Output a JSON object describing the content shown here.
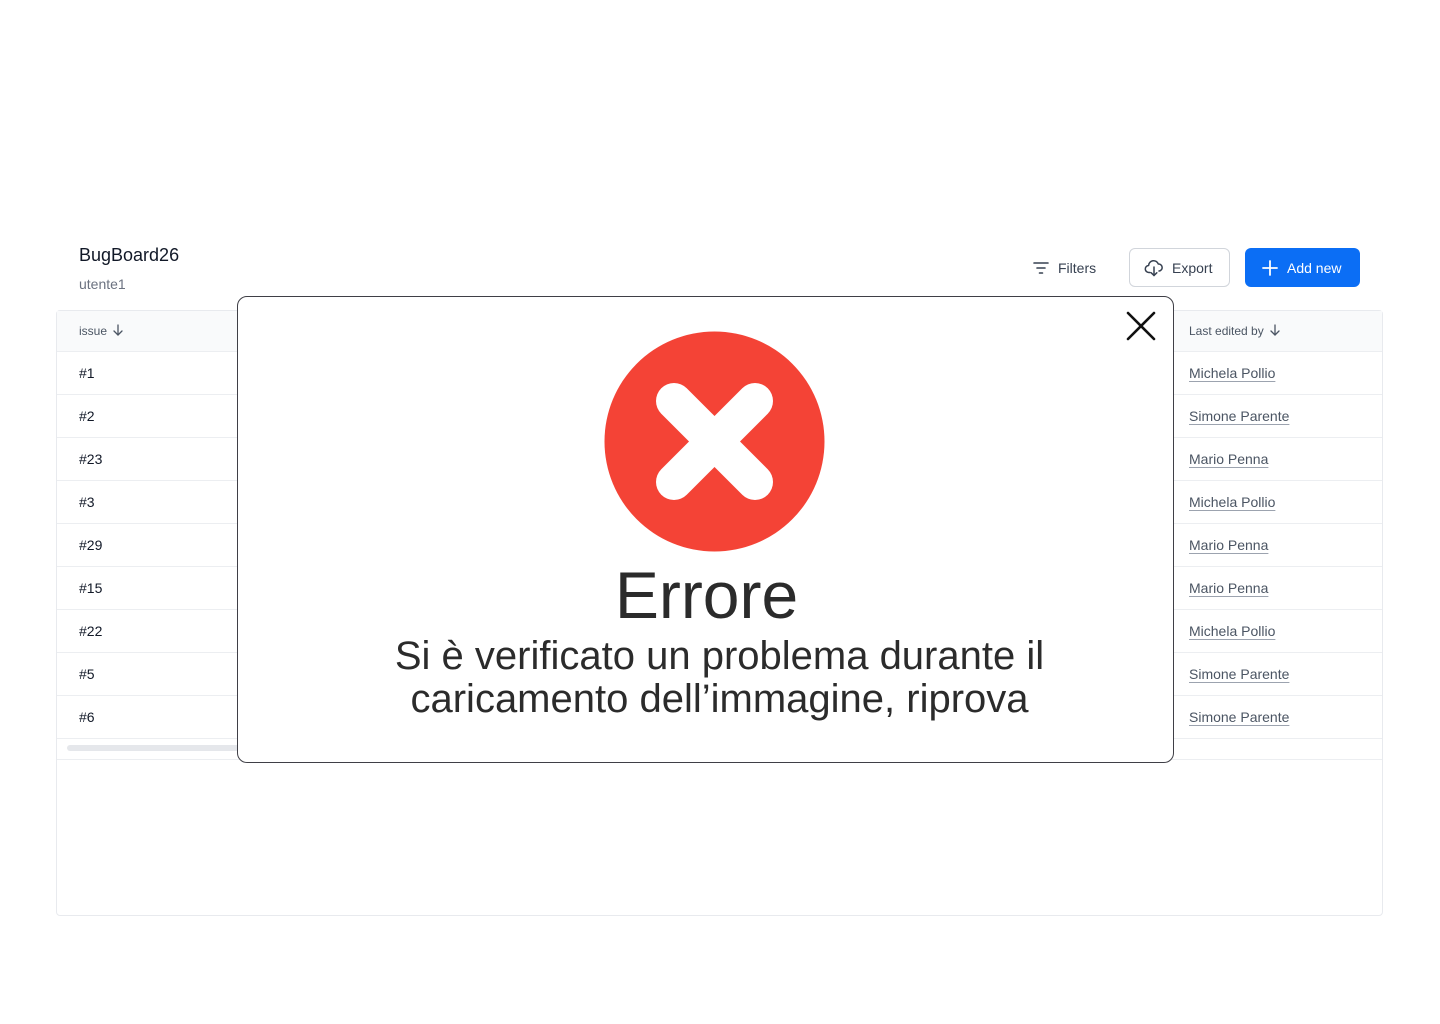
{
  "header": {
    "title": "BugBoard26",
    "user": "utente1"
  },
  "toolbar": {
    "filters_label": "Filters",
    "export_label": "Export",
    "add_label": "Add new"
  },
  "table": {
    "columns": {
      "issue": "issue",
      "last_edited_by": "Last edited by"
    },
    "rows": [
      {
        "issue": "#1",
        "last_edited_by": "Michela Pollio"
      },
      {
        "issue": "#2",
        "last_edited_by": "Simone Parente"
      },
      {
        "issue": "#23",
        "last_edited_by": "Mario Penna"
      },
      {
        "issue": "#3",
        "last_edited_by": "Michela Pollio"
      },
      {
        "issue": "#29",
        "last_edited_by": "Mario Penna"
      },
      {
        "issue": "#15",
        "last_edited_by": "Mario Penna"
      },
      {
        "issue": "#22",
        "last_edited_by": "Michela Pollio"
      },
      {
        "issue": "#5",
        "last_edited_by": "Simone Parente"
      },
      {
        "issue": "#6",
        "last_edited_by": "Simone Parente"
      }
    ]
  },
  "modal": {
    "title": "Errore",
    "message_line1": "Si è verificato un problema durante il",
    "message_line2": "caricamento dell’immagine, riprova",
    "icon": "error-x-circle-icon"
  },
  "colors": {
    "accent": "#0b6ef5",
    "error": "#f44336"
  }
}
